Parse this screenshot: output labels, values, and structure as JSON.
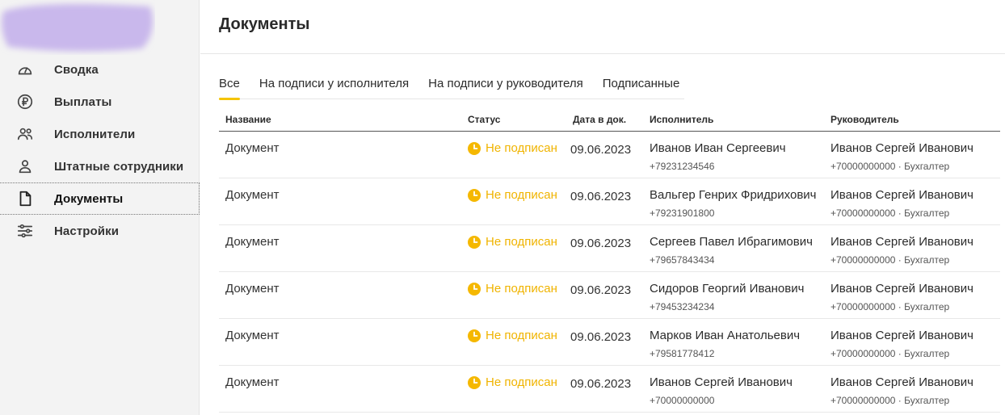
{
  "sidebar": {
    "items": [
      {
        "label": "Сводка",
        "icon": "gauge-icon",
        "active": false
      },
      {
        "label": "Выплаты",
        "icon": "ruble-icon",
        "active": false
      },
      {
        "label": "Исполнители",
        "icon": "users-icon",
        "active": false
      },
      {
        "label": "Штатные сотрудники",
        "icon": "user-icon",
        "active": false
      },
      {
        "label": "Документы",
        "icon": "document-icon",
        "active": true
      },
      {
        "label": "Настройки",
        "icon": "sliders-icon",
        "active": false
      }
    ]
  },
  "main": {
    "title": "Документы",
    "tabs": [
      {
        "label": "Все",
        "active": true
      },
      {
        "label": "На подписи у исполнителя",
        "active": false
      },
      {
        "label": "На подписи у руководителя",
        "active": false
      },
      {
        "label": "Подписанные",
        "active": false
      }
    ],
    "table": {
      "headers": {
        "name": "Название",
        "status": "Статус",
        "date": "Дата в док.",
        "executor": "Исполнитель",
        "manager": "Руководитель"
      },
      "rows": [
        {
          "name": "Документ",
          "status": "Не подписан",
          "date": "09.06.2023",
          "executor_name": "Иванов Иван Сергеевич",
          "executor_phone": "+79231234546",
          "manager_name": "Иванов Сергей Иванович",
          "manager_sub": "+70000000000 · Бухгалтер"
        },
        {
          "name": "Документ",
          "status": "Не подписан",
          "date": "09.06.2023",
          "executor_name": "Вальгер Генрих Фридрихович",
          "executor_phone": "+79231901800",
          "manager_name": "Иванов Сергей Иванович",
          "manager_sub": "+70000000000 · Бухгалтер"
        },
        {
          "name": "Документ",
          "status": "Не подписан",
          "date": "09.06.2023",
          "executor_name": "Сергеев Павел Ибрагимович",
          "executor_phone": "+79657843434",
          "manager_name": "Иванов Сергей Иванович",
          "manager_sub": "+70000000000 · Бухгалтер"
        },
        {
          "name": "Документ",
          "status": "Не подписан",
          "date": "09.06.2023",
          "executor_name": "Сидоров Георгий Иванович",
          "executor_phone": "+79453234234",
          "manager_name": "Иванов Сергей Иванович",
          "manager_sub": "+70000000000 · Бухгалтер"
        },
        {
          "name": "Документ",
          "status": "Не подписан",
          "date": "09.06.2023",
          "executor_name": "Марков Иван Анатольевич",
          "executor_phone": "+79581778412",
          "manager_name": "Иванов Сергей Иванович",
          "manager_sub": "+70000000000 · Бухгалтер"
        },
        {
          "name": "Документ",
          "status": "Не подписан",
          "date": "09.06.2023",
          "executor_name": "Иванов Сергей Иванович",
          "executor_phone": "+70000000000",
          "manager_name": "Иванов Сергей Иванович",
          "manager_sub": "+70000000000 · Бухгалтер"
        }
      ]
    }
  },
  "colors": {
    "accent": "#f5c400",
    "status_pending": "#f0b400",
    "logo_blur": "#c9b8ec",
    "sidebar_bg": "#f3f3f3"
  }
}
